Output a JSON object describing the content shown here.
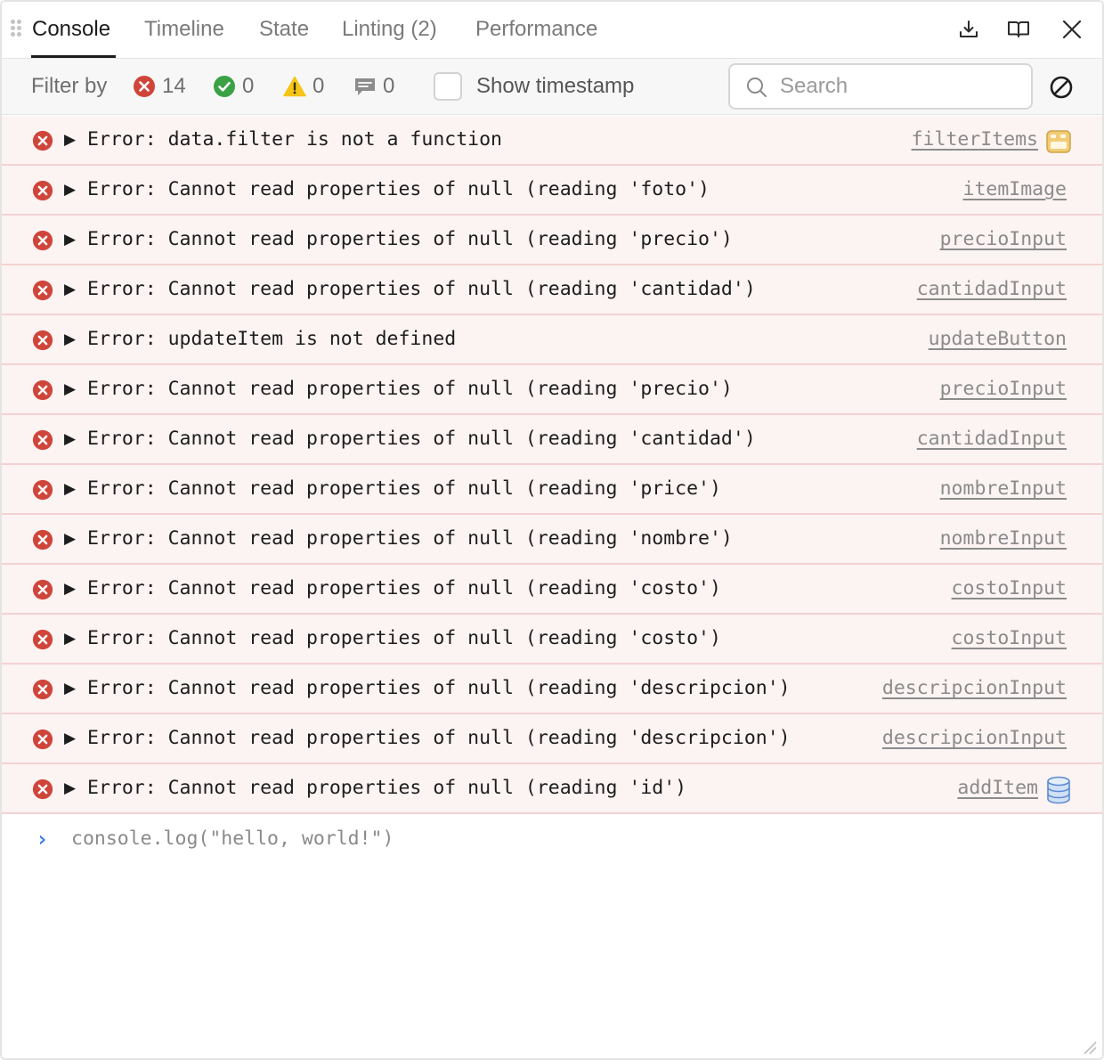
{
  "tabs": [
    {
      "label": "Console",
      "active": true
    },
    {
      "label": "Timeline",
      "active": false
    },
    {
      "label": "State",
      "active": false
    },
    {
      "label": "Linting (2)",
      "active": false
    },
    {
      "label": "Performance",
      "active": false
    }
  ],
  "toolbar": {
    "download_icon": "download-icon",
    "docs_icon": "book-icon",
    "close_icon": "close-icon"
  },
  "filter": {
    "label": "Filter by",
    "errors": "14",
    "success": "0",
    "warnings": "0",
    "messages": "0",
    "show_timestamp_label": "Show timestamp",
    "search_placeholder": "Search"
  },
  "colors": {
    "error": "#d0453a",
    "success": "#3aa245",
    "warning": "#f5c518",
    "row_bg": "#fcf3f3",
    "row_border": "#f3d2d2",
    "prompt": "#3f7ee6"
  },
  "logs": [
    {
      "message": "Error: data.filter is not a function",
      "source": "filterItems",
      "source_icon": "component-icon"
    },
    {
      "message": "Error: Cannot read properties of null (reading 'foto')",
      "source": "itemImage"
    },
    {
      "message": "Error: Cannot read properties of null (reading 'precio')",
      "source": "precioInput"
    },
    {
      "message": "Error: Cannot read properties of null (reading 'cantidad')",
      "source": "cantidadInput"
    },
    {
      "message": "Error: updateItem is not defined",
      "source": "updateButton"
    },
    {
      "message": "Error: Cannot read properties of null (reading 'precio')",
      "source": "precioInput"
    },
    {
      "message": "Error: Cannot read properties of null (reading 'cantidad')",
      "source": "cantidadInput"
    },
    {
      "message": "Error: Cannot read properties of null (reading 'price')",
      "source": "nombreInput"
    },
    {
      "message": "Error: Cannot read properties of null (reading 'nombre')",
      "source": "nombreInput"
    },
    {
      "message": "Error: Cannot read properties of null (reading 'costo')",
      "source": "costoInput"
    },
    {
      "message": "Error: Cannot read properties of null (reading 'costo')",
      "source": "costoInput"
    },
    {
      "message": "Error: Cannot read properties of null (reading 'descripcion')",
      "source": "descripcionInput"
    },
    {
      "message": "Error: Cannot read properties of null (reading 'descripcion')",
      "source": "descripcionInput"
    },
    {
      "message": "Error: Cannot read properties of null (reading 'id')",
      "source": "addItem",
      "source_icon": "database-icon"
    }
  ],
  "console_input": {
    "prompt": "›",
    "command": "console.log(\"hello, world!\")"
  }
}
